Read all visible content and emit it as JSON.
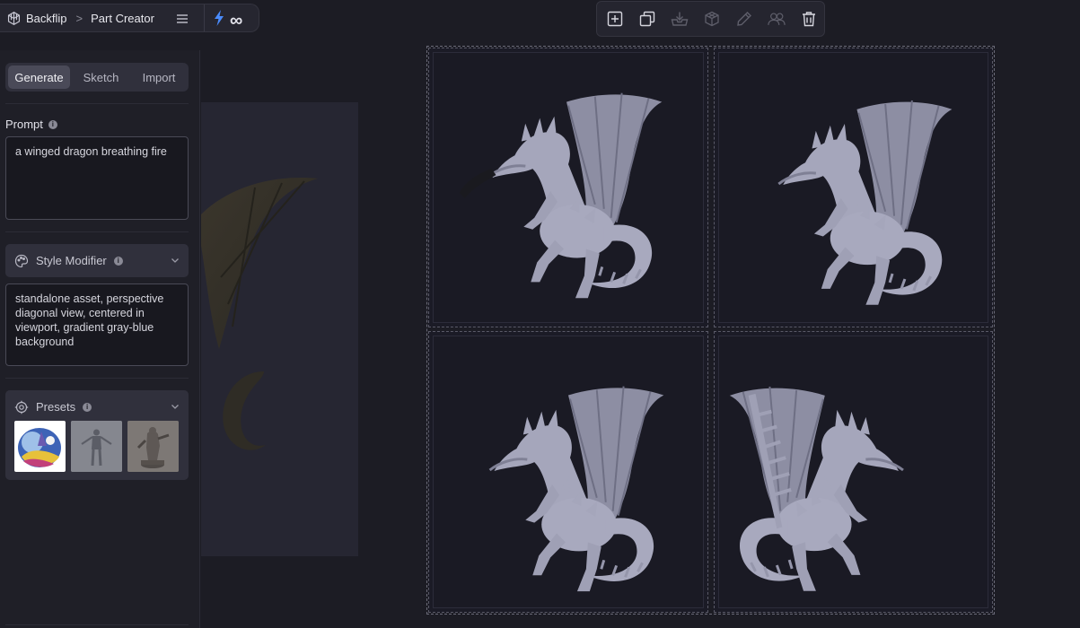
{
  "header": {
    "app_name": "Backflip",
    "breadcrumb": "Part Creator",
    "breadcrumb_separator": ">",
    "credits_symbol": "∞"
  },
  "tabs": [
    {
      "label": "Generate",
      "active": true
    },
    {
      "label": "Sketch",
      "active": false
    },
    {
      "label": "Import",
      "active": false
    }
  ],
  "prompt": {
    "label": "Prompt",
    "value": "a winged dragon breathing fire"
  },
  "style_modifier": {
    "label": "Style Modifier",
    "value": "standalone asset, perspective diagonal view, centered in viewport, gradient gray-blue background"
  },
  "presets": {
    "label": "Presets",
    "items": [
      {
        "name": "watercolor-preset"
      },
      {
        "name": "humanoid-preset"
      },
      {
        "name": "miniature-preset"
      }
    ]
  },
  "toolbar": {
    "tools": [
      "add-icon",
      "duplicate-icon",
      "download-icon",
      "cube-icon",
      "edit-icon",
      "users-icon",
      "trash-icon"
    ]
  },
  "results": {
    "count": 4
  },
  "colors": {
    "accent": "#4a8cff",
    "model_gray": "#a8a9be",
    "background": "#1c1c24"
  }
}
